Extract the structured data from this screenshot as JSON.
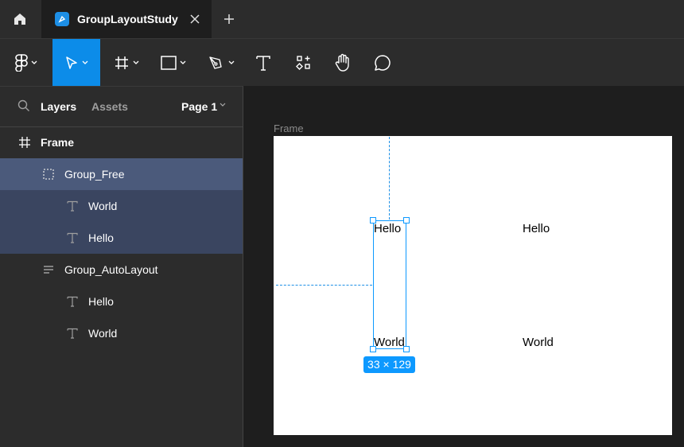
{
  "tabbar": {
    "home_icon": "home-icon",
    "tab": {
      "title": "GroupLayoutStudy",
      "icon": "figma-file-icon"
    },
    "new_tab_icon": "plus-icon"
  },
  "toolbar": {
    "tools": [
      {
        "name": "main-menu",
        "icon": "figma-logo-icon"
      },
      {
        "name": "move-tool",
        "icon": "cursor-icon",
        "active": true
      },
      {
        "name": "frame-tool",
        "icon": "hash-icon"
      },
      {
        "name": "shape-tool",
        "icon": "rectangle-icon"
      },
      {
        "name": "pen-tool",
        "icon": "pen-icon"
      },
      {
        "name": "text-tool",
        "icon": "text-icon"
      },
      {
        "name": "resources-tool",
        "icon": "components-icon"
      },
      {
        "name": "hand-tool",
        "icon": "hand-icon"
      },
      {
        "name": "comment-tool",
        "icon": "comment-icon"
      }
    ],
    "accent_color": "#0c8ce9"
  },
  "layers_panel": {
    "search_icon": "search-icon",
    "tabs": {
      "layers": "Layers",
      "assets": "Assets"
    },
    "page": "Page 1",
    "layers": [
      {
        "label": "Frame",
        "icon": "frame-icon",
        "depth": 0,
        "bold": true
      },
      {
        "label": "Group_Free",
        "icon": "group-icon",
        "depth": 1,
        "selected": true
      },
      {
        "label": "World",
        "icon": "text-icon",
        "depth": 2,
        "selected_child": true
      },
      {
        "label": "Hello",
        "icon": "text-icon",
        "depth": 2,
        "selected_child": true
      },
      {
        "label": "Group_AutoLayout",
        "icon": "autolayout-icon",
        "depth": 1
      },
      {
        "label": "Hello",
        "icon": "text-icon",
        "depth": 2
      },
      {
        "label": "World",
        "icon": "text-icon",
        "depth": 2
      }
    ]
  },
  "canvas": {
    "frame_label": "Frame",
    "texts": [
      "Hello",
      "World",
      "Hello",
      "World"
    ],
    "selection_size": "33 × 129",
    "selection_color": "#0d99ff"
  }
}
